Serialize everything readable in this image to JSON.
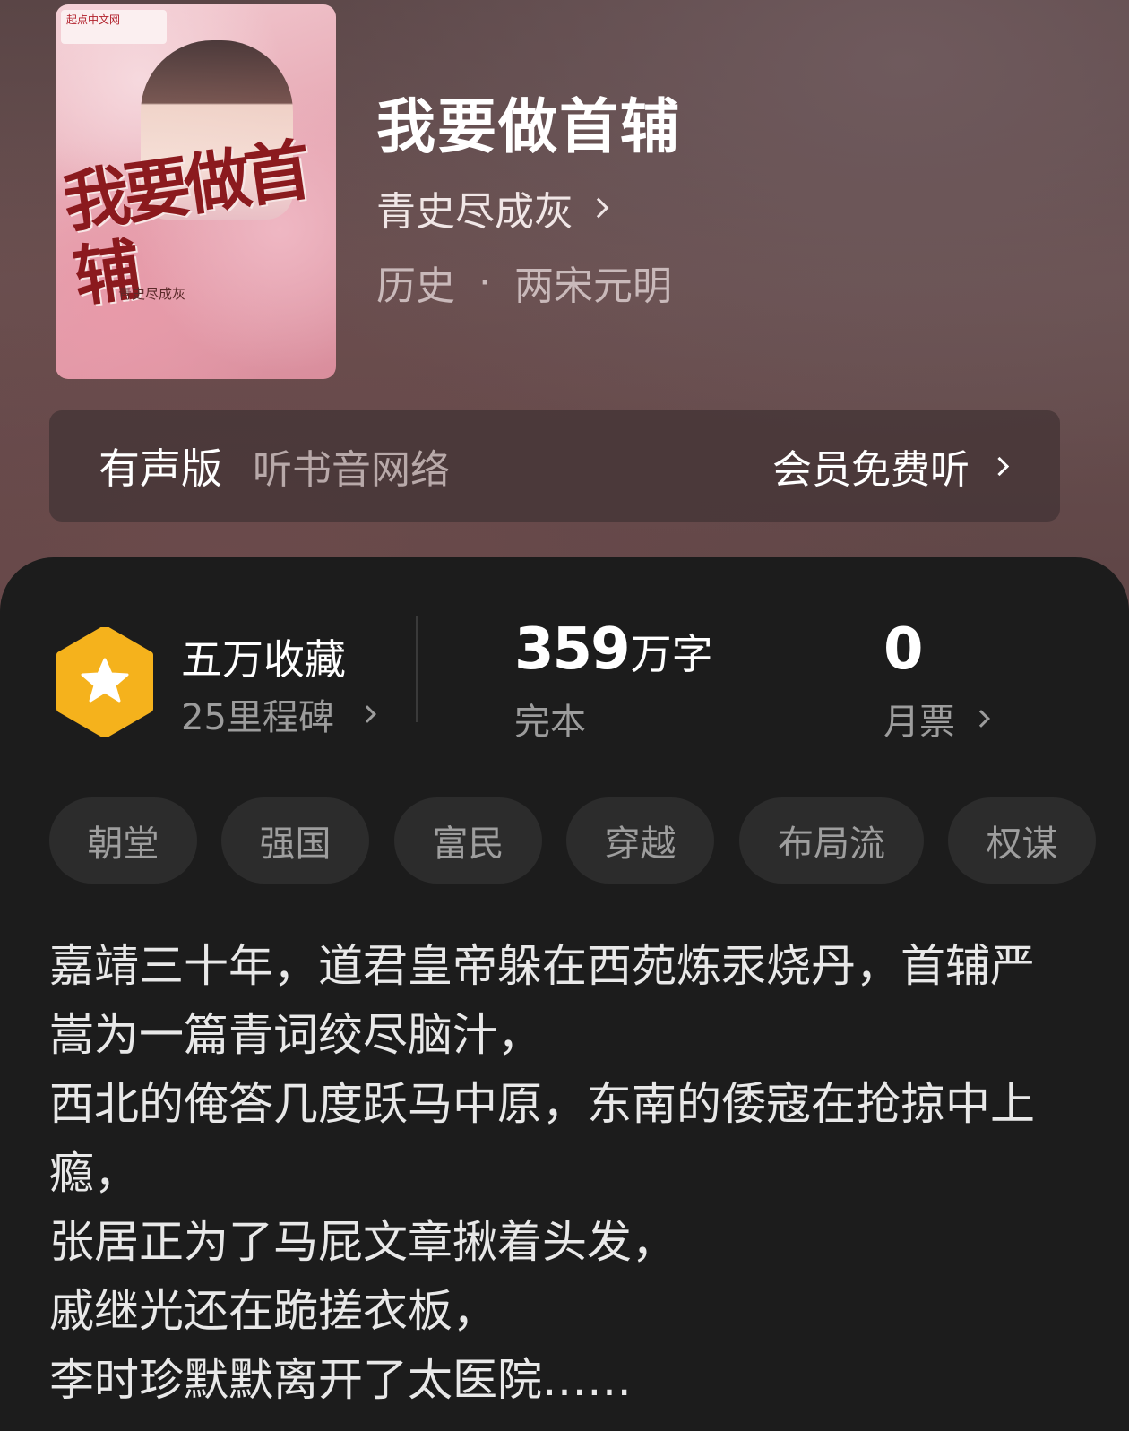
{
  "book": {
    "title": "我要做首辅",
    "author": "青史尽成灰",
    "category": "历史",
    "subcategory": "两宋元明",
    "separator": "·",
    "cover": {
      "title_text": "我要做首辅",
      "author_text": "青史尽成灰",
      "badge_text": "起点中文网"
    }
  },
  "audio": {
    "label": "有声版",
    "source": "听书音网络",
    "cta": "会员免费听"
  },
  "stats": {
    "favorites_title": "五万收藏",
    "milestones": "25里程碑",
    "word_count_number": "359",
    "word_count_unit": "万字",
    "status": "完本",
    "monthly_votes": "0",
    "monthly_votes_label": "月票"
  },
  "tags": [
    "朝堂",
    "强国",
    "富民",
    "穿越",
    "布局流",
    "权谋"
  ],
  "synopsis": [
    "嘉靖三十年，道君皇帝躲在西苑炼汞烧丹，首辅严嵩为一篇青词绞尽脑汁，",
    "西北的俺答几度跃马中原，东南的倭寇在抢掠中上瘾，",
    "张居正为了马屁文章揪着头发，",
    "戚继光还在跪搓衣板，",
    "李时珍默默离开了太医院……"
  ],
  "colors": {
    "hex_badge": "#f5b21c",
    "panel_bg": "#1c1c1c",
    "hero_bg": "#5e4646"
  }
}
